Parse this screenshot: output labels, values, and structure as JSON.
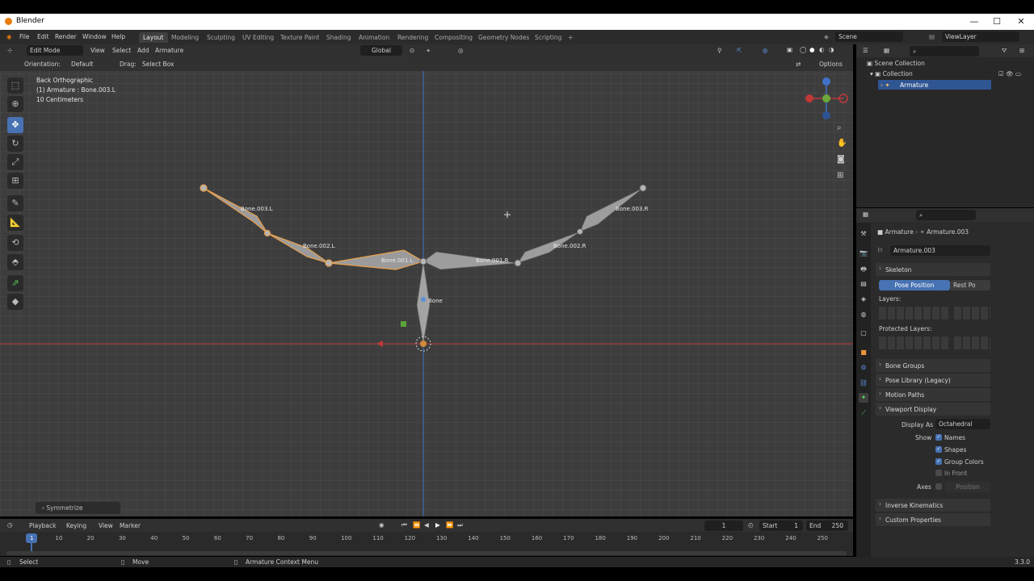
{
  "window": {
    "title": "Blender",
    "minimize": "—",
    "maximize": "☐",
    "close": "✕"
  },
  "menu": {
    "items": [
      "File",
      "Edit",
      "Render",
      "Window",
      "Help"
    ]
  },
  "workspaces": {
    "tabs": [
      "Layout",
      "Modeling",
      "Sculpting",
      "UV Editing",
      "Texture Paint",
      "Shading",
      "Animation",
      "Rendering",
      "Compositing",
      "Geometry Nodes",
      "Scripting"
    ],
    "active": "Layout",
    "add": "+"
  },
  "scene": {
    "name": "Scene",
    "view_layer": "ViewLayer"
  },
  "viewport_header": {
    "mode": "Edit Mode",
    "menus": [
      "View",
      "Select",
      "Add",
      "Armature"
    ],
    "transform_orientation": "Global",
    "orientation_label": "Orientation:",
    "orientation_value": "Default",
    "drag_label": "Drag:",
    "drag_value": "Select Box",
    "options": "Options"
  },
  "viewport_info": {
    "line1": "Back Orthographic",
    "line2": "(1) Armature : Bone.003.L",
    "line3": "10 Centimeters"
  },
  "bones": [
    "Bone.003.L",
    "Bone.002.L",
    "Bone.001.L",
    "Bone.001.R",
    "Bone.002.R",
    "Bone.003.R",
    "Bone"
  ],
  "last_operator": "Symmetrize",
  "outliner": {
    "root": "Scene Collection",
    "collection": "Collection",
    "armature": "Armature"
  },
  "properties": {
    "breadcrumb_obj": "Armature",
    "breadcrumb_data": "Armature.003",
    "data_name": "Armature.003",
    "skeleton": "Skeleton",
    "pose_position": "Pose Position",
    "rest_position": "Rest Po",
    "layers": "Layers:",
    "protected_layers": "Protected Layers:",
    "bone_groups": "Bone Groups",
    "pose_library": "Pose Library (Legacy)",
    "motion_paths": "Motion Paths",
    "viewport_display": "Viewport Display",
    "display_as_label": "Display As",
    "display_as_value": "Octahedral",
    "show_label": "Show",
    "names": "Names",
    "shapes": "Shapes",
    "group_colors": "Group Colors",
    "in_front": "In Front",
    "axes_label": "Axes",
    "axes_position": "Position",
    "inverse_kinematics": "Inverse Kinematics",
    "custom_properties": "Custom Properties"
  },
  "timeline": {
    "menus": [
      "Playback",
      "Keying",
      "View",
      "Marker"
    ],
    "current_frame": "1",
    "start_label": "Start",
    "start": "1",
    "end_label": "End",
    "end": "250",
    "ticks": [
      "1",
      "10",
      "20",
      "30",
      "40",
      "50",
      "60",
      "70",
      "80",
      "90",
      "100",
      "110",
      "120",
      "130",
      "140",
      "150",
      "160",
      "170",
      "180",
      "190",
      "200",
      "210",
      "220",
      "230",
      "240",
      "250"
    ]
  },
  "status": {
    "select": "Select",
    "move": "Move",
    "context_menu": "Armature Context Menu",
    "version": "3.3.0"
  }
}
